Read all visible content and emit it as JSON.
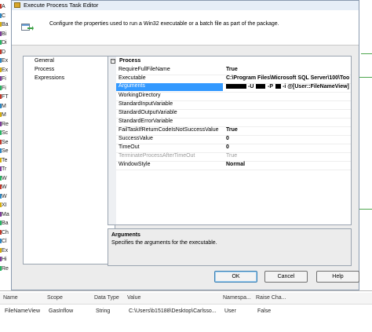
{
  "dialog": {
    "title": "Execute Process Task Editor",
    "banner_text": "Configure the properties used to run a Win32 executable or a batch file as part of the package."
  },
  "nav": {
    "items": [
      "General",
      "Process",
      "Expressions"
    ]
  },
  "grid": {
    "category": "Process",
    "rows": [
      {
        "name": "RequireFullFileName",
        "value": "True",
        "bold": true
      },
      {
        "name": "Executable",
        "value": "C:\\Program Files\\Microsoft SQL Server\\100\\Too",
        "bold": true
      },
      {
        "name": "Arguments",
        "value_parts": [
          "-U",
          "-P",
          "-i @[User::FileNameView]"
        ],
        "selected": true
      },
      {
        "name": "WorkingDirectory",
        "value": ""
      },
      {
        "name": "StandardInputVariable",
        "value": ""
      },
      {
        "name": "StandardOutputVariable",
        "value": ""
      },
      {
        "name": "StandardErrorVariable",
        "value": ""
      },
      {
        "name": "FailTaskIfReturnCodeIsNotSuccessValue",
        "value": "True",
        "bold": true
      },
      {
        "name": "SuccessValue",
        "value": "0",
        "bold": true
      },
      {
        "name": "TimeOut",
        "value": "0",
        "bold": true
      },
      {
        "name": "TerminateProcessAfterTimeOut",
        "value": "True",
        "dim": true
      },
      {
        "name": "WindowStyle",
        "value": "Normal",
        "bold": true
      }
    ]
  },
  "description": {
    "title": "Arguments",
    "text": "Specifies the arguments for the executable."
  },
  "buttons": {
    "ok": "OK",
    "cancel": "Cancel",
    "help": "Help"
  },
  "variables": {
    "columns": [
      "Name",
      "Scope",
      "Data Type",
      "Value",
      "Namespa...",
      "Raise Cha..."
    ],
    "row": [
      "FileNameView",
      "GasInflow",
      "String",
      "C:\\Users\\b15188\\Desktop\\Carlsso...",
      "User",
      "False"
    ]
  },
  "background": {
    "left_letters": [
      "A",
      "C",
      "Ba",
      "Bi",
      "Di",
      "D",
      "Ex",
      "Ex",
      "Fi",
      "Fi",
      "FT",
      "M",
      "M",
      "Re",
      "Sc",
      "Se",
      "Se",
      "Te",
      "Tr",
      "W",
      "W",
      "W",
      "XI",
      "Ma",
      "Ba",
      "Ch",
      "Cl",
      "Ex",
      "Hi",
      "Re"
    ]
  }
}
